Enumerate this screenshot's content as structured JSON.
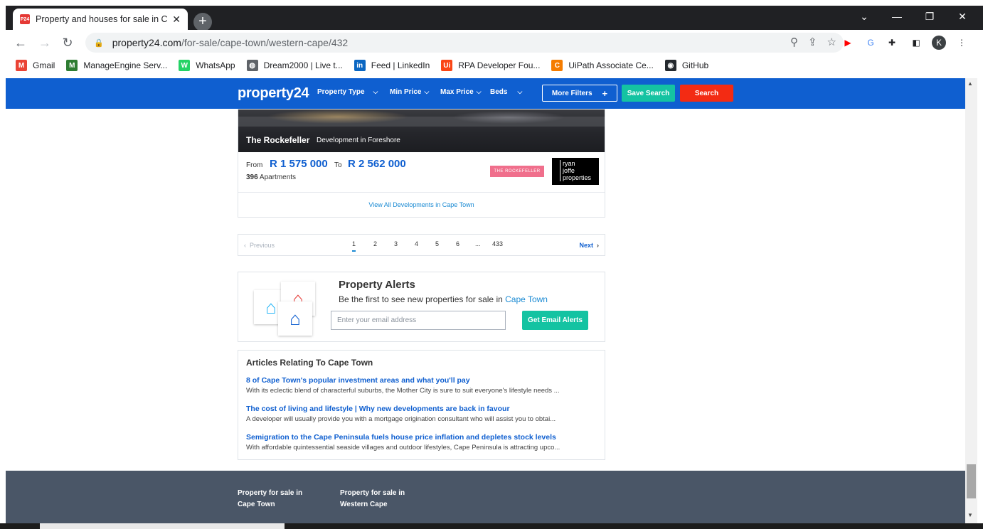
{
  "browser": {
    "tab_title": "Property and houses for sale in C",
    "tab_favicon": "P24",
    "url_host": "property24.com",
    "url_path": "/for-sale/cape-town/western-cape/432",
    "profile_initial": "K",
    "bookmarks": [
      {
        "label": "Gmail",
        "icon": "gmail-icon",
        "glyph": "M",
        "color": "#ea4335"
      },
      {
        "label": "ManageEngine Serv...",
        "icon": "manageengine-icon",
        "glyph": "M",
        "color": "#2e7d32"
      },
      {
        "label": "WhatsApp",
        "icon": "whatsapp-icon",
        "glyph": "W",
        "color": "#25d366"
      },
      {
        "label": "Dream2000 | Live t...",
        "icon": "globe-icon",
        "glyph": "◍",
        "color": "#5f6368"
      },
      {
        "label": "Feed | LinkedIn",
        "icon": "linkedin-icon",
        "glyph": "in",
        "color": "#0a66c2"
      },
      {
        "label": "RPA Developer Fou...",
        "icon": "uipath-icon",
        "glyph": "Ui",
        "color": "#fa4616"
      },
      {
        "label": "UiPath Associate Ce...",
        "icon": "coursera-icon",
        "glyph": "C",
        "color": "#f57c00"
      },
      {
        "label": "GitHub",
        "icon": "github-icon",
        "glyph": "◉",
        "color": "#24292e"
      }
    ]
  },
  "site": {
    "logo": "property24",
    "nav": {
      "property_type": "Property Type",
      "min_price": "Min Price",
      "max_price": "Max Price",
      "beds": "Beds",
      "more_filters": "More Filters",
      "save_search": "Save Search",
      "search": "Search"
    },
    "development": {
      "name": "The Rockefeller",
      "subtitle": "Development in Foreshore",
      "from_label": "From",
      "price_from": "R 1 575 000",
      "to_label": "To",
      "price_to": "R 2 562 000",
      "count": "396",
      "count_label": "Apartments",
      "brand_logo": "THE ROCKEFELLER",
      "agency_logo_lines": [
        "ryan",
        "joffe",
        "properties"
      ],
      "view_all": "View All Developments in Cape Town"
    },
    "pagination": {
      "previous": "Previous",
      "pages": [
        "1",
        "2",
        "3",
        "4",
        "5",
        "6",
        "...",
        "433"
      ],
      "active": "1",
      "next": "Next"
    },
    "alerts": {
      "title": "Property Alerts",
      "subtitle": "Be the first to see new properties for sale in",
      "city": "Cape Town",
      "email_placeholder": "Enter your email address",
      "button": "Get Email Alerts"
    },
    "articles": {
      "heading": "Articles Relating To Cape Town",
      "items": [
        {
          "title": "8 of Cape Town's popular investment areas and what you'll pay",
          "desc": "With its eclectic blend of characterful suburbs, the Mother City is sure to suit everyone's lifestyle needs ..."
        },
        {
          "title": "The cost of living and lifestyle | Why new developments are back in favour",
          "desc": "A developer will usually provide you with a mortgage origination consultant who will assist you to obtai..."
        },
        {
          "title": "Semigration to the Cape Peninsula fuels house price inflation and depletes stock levels",
          "desc": "With affordable quintessential seaside villages and outdoor lifestyles, Cape Peninsula is attracting upco..."
        }
      ]
    },
    "footer": {
      "col1": [
        "Property for sale in",
        "Cape Town"
      ],
      "col2": [
        "Property for sale in",
        "Western Cape"
      ]
    }
  }
}
